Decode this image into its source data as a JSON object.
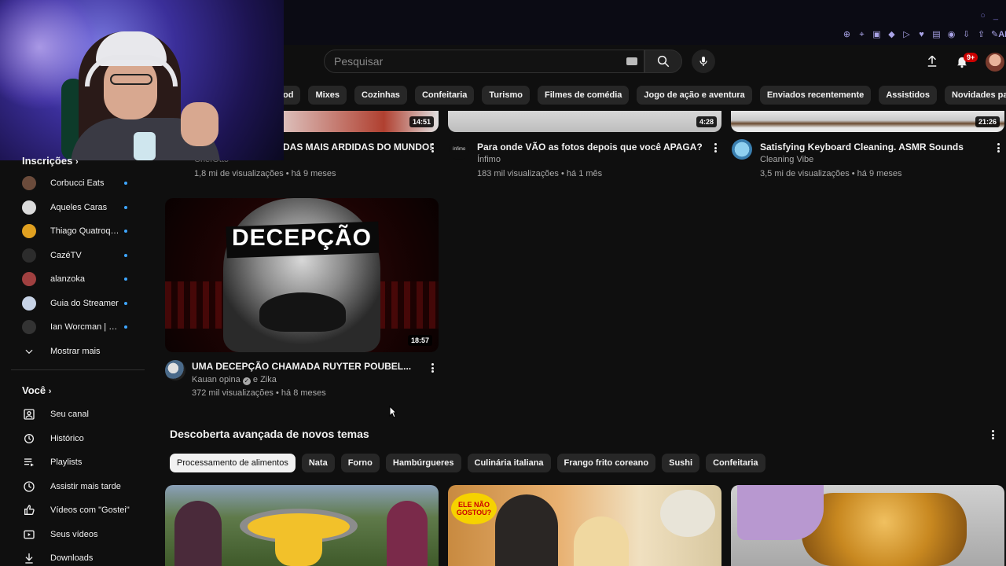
{
  "header": {
    "search_placeholder": "Pesquisar",
    "notification_count": "9+"
  },
  "chips": [
    "od",
    "Mixes",
    "Cozinhas",
    "Confeitaria",
    "Turismo",
    "Filmes de comédia",
    "Jogo de ação e aventura",
    "Enviados recentemente",
    "Assistidos",
    "Novidades para você"
  ],
  "sidebar": {
    "subscriptions_heading": "Inscrições",
    "subscriptions": [
      {
        "name": "Corbucci Eats",
        "color": "#6b4b3b"
      },
      {
        "name": "Aqueles Caras",
        "color": "#dcdcdc"
      },
      {
        "name": "Thiago Quatroque",
        "color": "#e0a020"
      },
      {
        "name": "CazéTV",
        "color": "#2c2c2c"
      },
      {
        "name": "alanzoka",
        "color": "#a04040"
      },
      {
        "name": "Guia do Streamer",
        "color": "#c7d3e6"
      },
      {
        "name": "Ian Worcman | O...",
        "color": "#333333"
      }
    ],
    "show_more": "Mostrar mais",
    "you_heading": "Você",
    "you_items": [
      {
        "label": "Seu canal",
        "icon": "channel-icon"
      },
      {
        "label": "Histórico",
        "icon": "history-icon"
      },
      {
        "label": "Playlists",
        "icon": "playlist-icon"
      },
      {
        "label": "Assistir mais tarde",
        "icon": "clock-icon"
      },
      {
        "label": "Vídeos com \"Gostei\"",
        "icon": "thumbs-up-icon"
      },
      {
        "label": "Seus vídeos",
        "icon": "video-icon"
      },
      {
        "label": "Downloads",
        "icon": "download-icon"
      }
    ]
  },
  "videos_row1": [
    {
      "title": "DAS MAIS ARDIDAS DO MUNDO!",
      "channel": "ChefOtto",
      "meta": "1,8 mi de visualizações • há 9 meses",
      "duration": "14:51"
    },
    {
      "title": "Para onde VÃO as fotos depois que você APAGA?",
      "channel": "Ínfimo",
      "meta": "183 mil visualizações • há 1 mês",
      "duration": "4:28"
    },
    {
      "title": "Satisfying Keyboard Cleaning. ASMR Sounds",
      "channel": "Cleaning Vibe",
      "meta": "3,5 mi de visualizações • há 9 meses",
      "duration": "21:26"
    }
  ],
  "featured_video": {
    "thumb_text": "DECEPÇÃO",
    "title": "UMA DECEPÇÃO CHAMADA RUYTER POUBEL...",
    "channel": "Kauan opina",
    "channel_extra": "e Zika",
    "meta": "372 mil visualizações • há 8 meses",
    "duration": "18:57"
  },
  "discover": {
    "title": "Descoberta avançada de novos temas",
    "chips": [
      "Processamento de alimentos",
      "Nata",
      "Forno",
      "Hambúrgueres",
      "Culinária italiana",
      "Frango frito coreano",
      "Sushi",
      "Confeitaria"
    ]
  },
  "colors": {
    "background": "#0f0f0f",
    "chip": "#272727",
    "accent_blue": "#3ea6ff",
    "badge_red": "#cc0000"
  }
}
